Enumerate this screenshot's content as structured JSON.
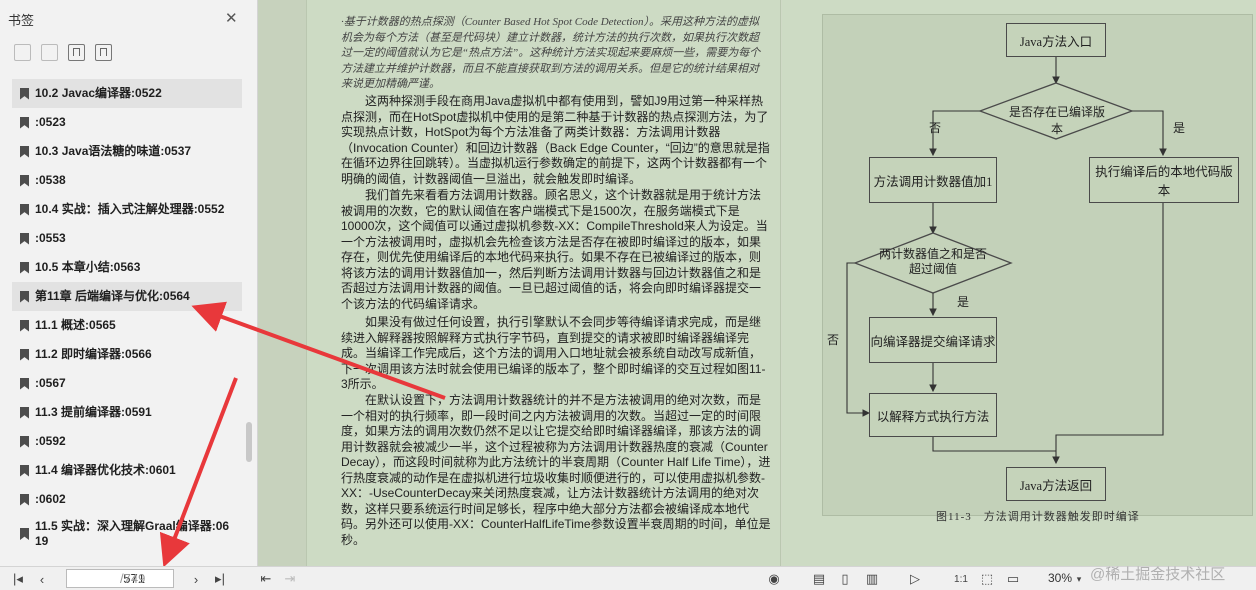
{
  "sidebar": {
    "title": "书签",
    "bookmarks": [
      {
        "label": "10.2 Javac编译器:0522"
      },
      {
        "label": ":0523"
      },
      {
        "label": "10.3 Java语法糖的味道:0537"
      },
      {
        "label": ":0538"
      },
      {
        "label": "10.4 实战：插入式注解处理器:0552"
      },
      {
        "label": ":0553"
      },
      {
        "label": "10.5 本章小结:0563"
      },
      {
        "label": "第11章 后端编译与优化:0564"
      },
      {
        "label": "11.1 概述:0565"
      },
      {
        "label": "11.2 即时编译器:0566"
      },
      {
        "label": ":0567"
      },
      {
        "label": "11.3 提前编译器:0591"
      },
      {
        "label": ":0592"
      },
      {
        "label": "11.4 编译器优化技术:0601"
      },
      {
        "label": ":0602"
      },
      {
        "label": "11.5 实战：深入理解Graal编译器:0619"
      }
    ]
  },
  "document": {
    "quote": "·基于计数器的热点探测（Counter Based Hot Spot Code Detection）。采用这种方法的虚拟机会为每个方法（甚至是代码块）建立计数器，统计方法的执行次数，如果执行次数超过一定的阈值就认为它是“热点方法”。这种统计方法实现起来要麻烦一些，需要为每个方法建立并维护计数器，而且不能直接获取到方法的调用关系。但是它的统计结果相对来说更加精确严谨。",
    "paragraphs": [
      "这两种探测手段在商用Java虚拟机中都有使用到，譬如J9用过第一种采样热点探测，而在HotSpot虚拟机中使用的是第二种基于计数器的热点探测方法，为了实现热点计数，HotSpot为每个方法准备了两类计数器：方法调用计数器（Invocation Counter）和回边计数器（Back Edge Counter，“回边”的意思就是指在循环边界往回跳转）。当虚拟机运行参数确定的前提下，这两个计数器都有一个明确的阈值，计数器阈值一旦溢出，就会触发即时编译。",
      "我们首先来看看方法调用计数器。顾名思义，这个计数器就是用于统计方法被调用的次数，它的默认阈值在客户端模式下是1500次，在服务端模式下是10000次，这个阈值可以通过虚拟机参数-XX：CompileThreshold来人为设定。当一个方法被调用时，虚拟机会先检查该方法是否存在被即时编译过的版本，如果存在，则优先使用编译后的本地代码来执行。如果不存在已被编译过的版本，则将该方法的调用计数器值加一，然后判断方法调用计数器与回边计数器值之和是否超过方法调用计数器的阈值。一旦已超过阈值的话，将会向即时编译器提交一个该方法的代码编译请求。",
      "如果没有做过任何设置，执行引擎默认不会同步等待编译请求完成，而是继续进入解释器按照解释方式执行字节码，直到提交的请求被即时编译器编译完成。当编译工作完成后，这个方法的调用入口地址就会被系统自动改写成新值，下一次调用该方法时就会使用已编译的版本了，整个即时编译的交互过程如图11-3所示。",
      "在默认设置下，方法调用计数器统计的并不是方法被调用的绝对次数，而是一个相对的执行频率，即一段时间之内方法被调用的次数。当超过一定的时间限度，如果方法的调用次数仍然不足以让它提交给即时编译器编译，那该方法的调用计数器就会被减少一半，这个过程被称为方法调用计数器热度的衰减（Counter Decay），而这段时间就称为此方法统计的半衰周期（Counter Half Life Time），进行热度衰减的动作是在虚拟机进行垃圾收集时顺便进行的，可以使用虚拟机参数-XX：-UseCounterDecay来关闭热度衰减，让方法计数器统计方法调用的绝对次数，这样只要系统运行时间足够长，程序中绝大部分方法都会被编译成本地代码。另外还可以使用-XX：CounterHalfLifeTime参数设置半衰周期的时间，单位是秒。"
    ]
  },
  "diagram": {
    "entry": "Java方法入口",
    "decision1": "是否存在已编译版本",
    "no1": "否",
    "yes1": "是",
    "counter": "方法调用计数器值加1",
    "native": "执行编译后的本地代码版本",
    "decision2_line1": "两计数器值之和是否",
    "decision2_line2": "超过阈值",
    "yes2": "是",
    "no2": "否",
    "submit": "向编译器提交编译请求",
    "interpret": "以解释方式执行方法",
    "return": "Java方法返回",
    "caption": "图11-3　方法调用计数器触发即时编译"
  },
  "statusbar": {
    "current_page": "571",
    "total_pages": "/749",
    "zoom": "30%"
  },
  "watermark": "@稀土掘金技术社区",
  "colors": {
    "annotation_arrow": "#e8383b",
    "page_background": "#cddbc4"
  }
}
